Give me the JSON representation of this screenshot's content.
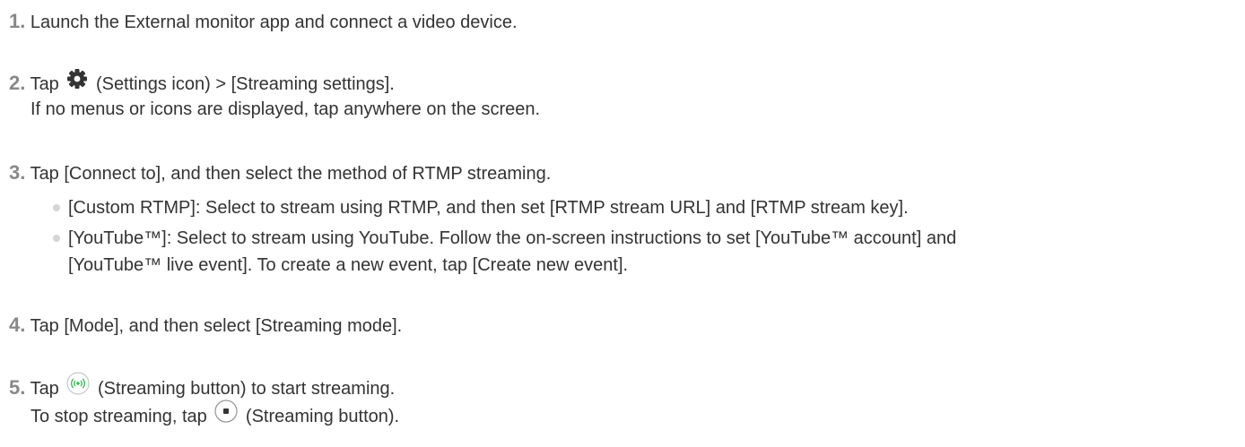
{
  "steps": [
    {
      "number": "1.",
      "text": "Launch the External monitor app and connect a video device."
    },
    {
      "number": "2.",
      "before_icon": "Tap",
      "icon": "gear-icon",
      "after_icon": "(Settings icon) > [Streaming settings].",
      "note": "If no menus or icons are displayed, tap anywhere on the screen."
    },
    {
      "number": "3.",
      "text": "Tap [Connect to], and then select the method of RTMP streaming.",
      "bullets": [
        {
          "line1": "[Custom RTMP]: Select to stream using RTMP, and then set [RTMP stream URL] and [RTMP stream key]."
        },
        {
          "line1": "[YouTube™]: Select to stream using YouTube. Follow the on-screen instructions to set [YouTube™ account] and",
          "line2": "[YouTube™ live event]. To create a new event, tap [Create new event]."
        }
      ]
    },
    {
      "number": "4.",
      "text": "Tap [Mode], and then select [Streaming mode]."
    },
    {
      "number": "5.",
      "before_icon": "Tap",
      "icon": "streaming-start-icon",
      "after_icon": "(Streaming button) to start streaming.",
      "note_before_icon": "To stop streaming, tap",
      "note_icon": "streaming-stop-icon",
      "note_after_icon": "(Streaming button)."
    }
  ],
  "colors": {
    "text": "#333333",
    "step_number": "#888888",
    "bullet": "#d5d5d5",
    "stream_green": "#2fb84f"
  }
}
